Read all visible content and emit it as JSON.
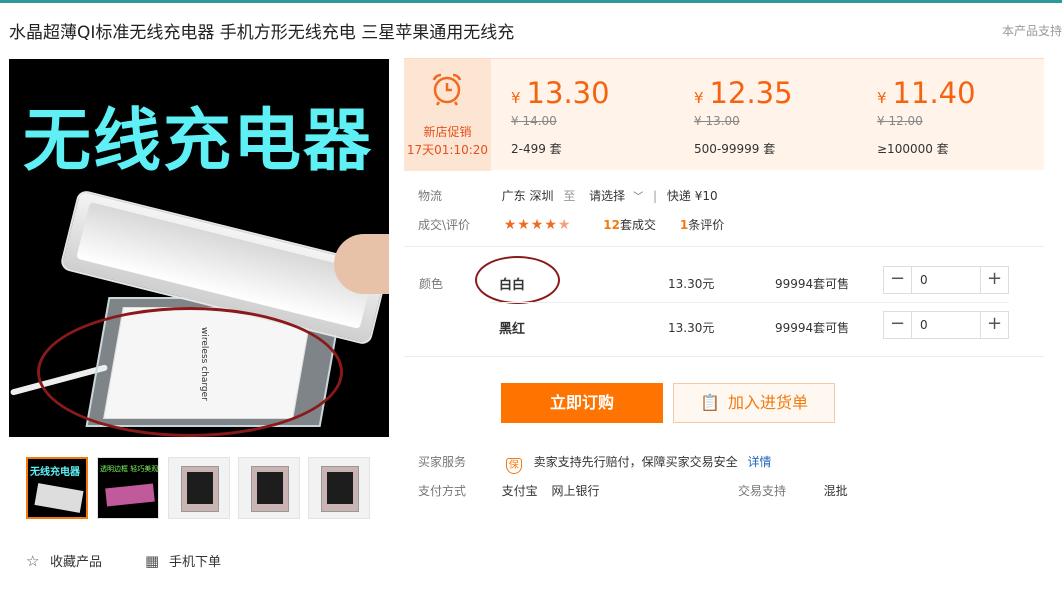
{
  "product": {
    "title": "水晶超薄QI标准无线充电器 手机方形无线充电 三星苹果通用无线充",
    "title_right": "本产品支持",
    "main_image_text": "无线充电器",
    "charger_print": "wireless charger"
  },
  "thumbs": {
    "t1_text": "无线充电器",
    "t2_text": "透明边框 轻巧美观"
  },
  "actions": {
    "favorite": "收藏产品",
    "mobile_order": "手机下单"
  },
  "promo": {
    "label": "新店促销",
    "countdown": "17天01:10:20"
  },
  "tiers": [
    {
      "currency": "¥",
      "price": "13.30",
      "original": "¥ 14.00",
      "range": "2-499 套"
    },
    {
      "currency": "¥",
      "price": "12.35",
      "original": "¥ 13.00",
      "range": "500-99999 套"
    },
    {
      "currency": "¥",
      "price": "11.40",
      "original": "¥ 12.00",
      "range": "≥100000 套"
    }
  ],
  "logistics": {
    "label": "物流",
    "from": "广东 深圳",
    "to_word": "至",
    "select": "请选择",
    "shipping": "快递 ¥10"
  },
  "rating": {
    "label": "成交\\评价",
    "stars": 4.5,
    "deals_count": "12",
    "deals_unit": "套成交",
    "reviews_count": "1",
    "reviews_unit": "条评价"
  },
  "variants": {
    "label": "颜色",
    "items": [
      {
        "name": "白白",
        "price": "13.30元",
        "stock": "99994套可售",
        "qty": "0"
      },
      {
        "name": "黑红",
        "price": "13.30元",
        "stock": "99994套可售",
        "qty": "0"
      }
    ]
  },
  "buttons": {
    "buy": "立即订购",
    "cart": "加入进货单"
  },
  "service": {
    "label": "买家服务",
    "badge": "保",
    "text": "卖家支持先行赔付，保障买家交易安全",
    "link": "详情"
  },
  "payment": {
    "label": "支付方式",
    "methods": [
      "支付宝",
      "网上银行"
    ],
    "trade_label": "交易支持",
    "trade_value": "混批"
  },
  "colors": {
    "accent": "#ff7300",
    "teal": "#2a9a9a",
    "annotation": "#8a1a1a"
  }
}
